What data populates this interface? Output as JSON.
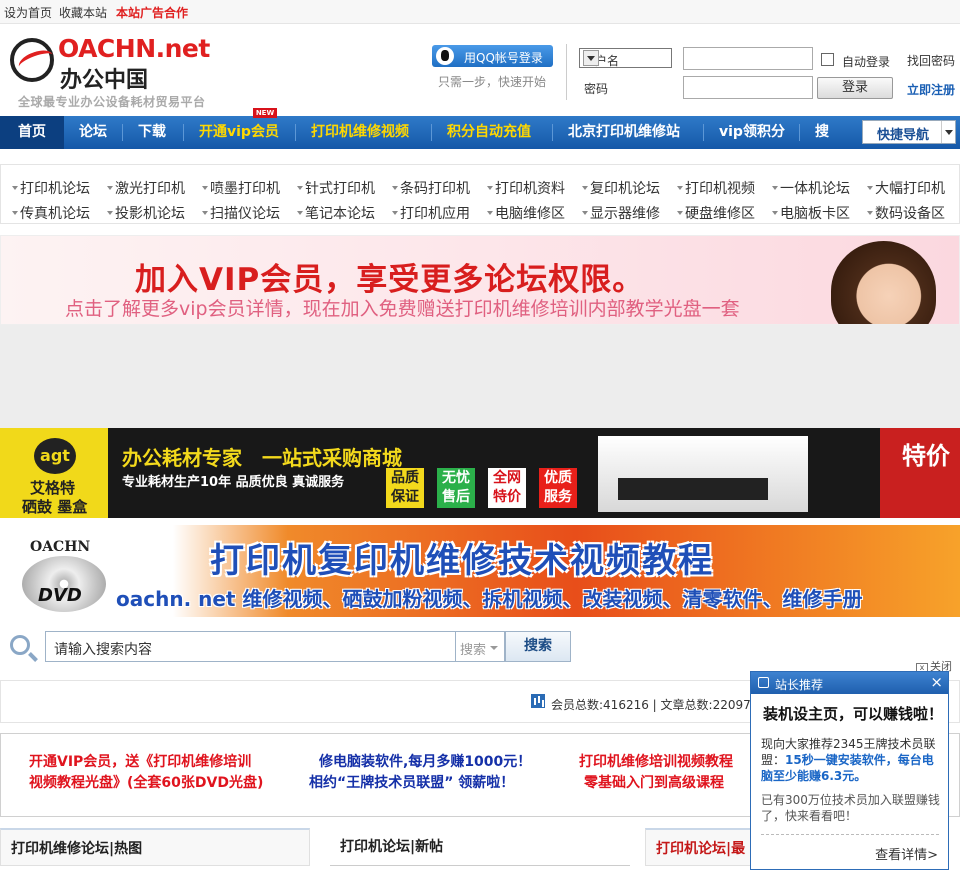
{
  "toplinks": {
    "home": "设为首页",
    "fav": "收藏本站",
    "ad": "本站广告合作"
  },
  "logo": {
    "brand": "OACHN.net",
    "cn": "办公中国",
    "slogan": "全球最专业办公设备耗材贸易平台"
  },
  "login": {
    "qq_label": "用QQ帐号登录",
    "qq_sub": "只需一步，快速开始",
    "username_select": "用户名",
    "password_label": "密码",
    "auto_login": "自动登录",
    "login_button": "登录",
    "forgot": "找回密码",
    "register": "立即注册"
  },
  "nav": {
    "items": [
      "首页",
      "论坛",
      "下载",
      "开通vip会员",
      "打印机维修视频",
      "积分自动充值",
      "北京打印机维修站",
      "vip领积分",
      "搜"
    ],
    "new_badge": "NEW",
    "quick_nav": "快捷导航"
  },
  "categories": {
    "row1": [
      "打印机论坛",
      "激光打印机",
      "喷墨打印机",
      "针式打印机",
      "条码打印机",
      "打印机资料",
      "复印机论坛",
      "打印机视频",
      "一体机论坛",
      "大幅打印机"
    ],
    "row2": [
      "传真机论坛",
      "投影机论坛",
      "扫描仪论坛",
      "笔记本论坛",
      "打印机应用",
      "电脑维修区",
      "显示器维修",
      "硬盘维修区",
      "电脑板卡区",
      "数码设备区"
    ]
  },
  "banners": {
    "vip": {
      "title": "加入VIP会员，享受更多论坛权限。",
      "sub": "点击了解更多vip会员详情，现在加入免费赠送打印机维修培训内部教学光盘一套"
    },
    "agt": {
      "logo": "agt",
      "brand": "艾格特",
      "products": "硒鼓 墨盒",
      "title": "办公耗材专家　一站式采购商城",
      "sub": "专业耗材生产10年 品质优良 真诚服务",
      "badges": [
        "品质保证",
        "无忧售后",
        "全网特价",
        "优质服务"
      ],
      "sale": "特价"
    },
    "dvd": {
      "logo": "OACHN",
      "dvd": "DVD",
      "title": "打印机复印机维修技术视频教程",
      "sub": "oachn. net  维修视频、硒鼓加粉视频、拆机视频、改装视频、清零软件、维修手册"
    }
  },
  "search": {
    "placeholder": "请输入搜索内容",
    "type": "搜索",
    "button": "搜索",
    "close_ad": "关闭"
  },
  "stats": {
    "text": "会员总数:416216 | 文章总数:220976"
  },
  "promos": [
    {
      "line1": "开通VIP会员，送《打印机维修培训",
      "line2": "视频教程光盘》(全套60张DVD光盘)",
      "color": "#e0141e"
    },
    {
      "line1": "修电脑装软件,每月多赚1000元！",
      "line2": "相约“王牌技术员联盟”  领薪啦！",
      "color": "#1530a8"
    },
    {
      "line1": "打印机维修培训视频教程",
      "line2": "零基础入门到高级课程",
      "color": "#e0141e"
    }
  ],
  "columns": [
    "打印机维修论坛|热图",
    "打印机论坛|新帖",
    "打印机论坛|最"
  ],
  "popup": {
    "header": "站长推荐",
    "title": "装机设主页，可以赚钱啦！",
    "line1_pre": "现向大家推荐2345王牌技术员联盟：",
    "line1_em": "15秒一键安装软件，每台电脑至少能赚6.3元。",
    "line2": "已有300万位技术员加入联盟赚钱了，快来看看吧！",
    "more": "查看详情>"
  }
}
